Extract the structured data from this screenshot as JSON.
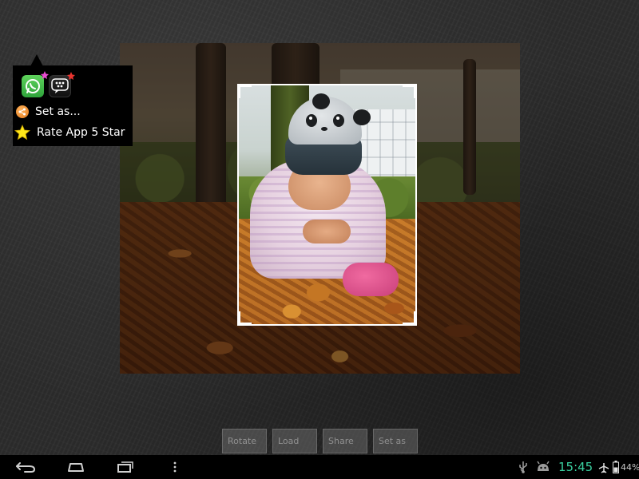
{
  "popup": {
    "share_apps": [
      {
        "name": "whatsapp-icon",
        "color": "#3dbb45"
      },
      {
        "name": "bbm-icon",
        "color": "#1a1a1a"
      }
    ],
    "items": [
      {
        "label": "Set as...",
        "icon": "share-icon"
      },
      {
        "label": "Rate App 5 Star",
        "icon": "star-icon"
      }
    ]
  },
  "actions": [
    {
      "label": "Rotate"
    },
    {
      "label": "Load"
    },
    {
      "label": "Share"
    },
    {
      "label": "Set as"
    }
  ],
  "status_bar": {
    "time": "15:45",
    "battery": "44%",
    "icons": [
      "usb-icon",
      "android-debug-icon",
      "airplane-mode-icon",
      "battery-icon"
    ]
  },
  "nav": [
    "back-icon",
    "home-icon",
    "recent-apps-icon",
    "overflow-menu-icon"
  ],
  "colors": {
    "clock": "#3ad0a0",
    "popup_bg": "#000000",
    "crop_border": "#ffffff"
  }
}
